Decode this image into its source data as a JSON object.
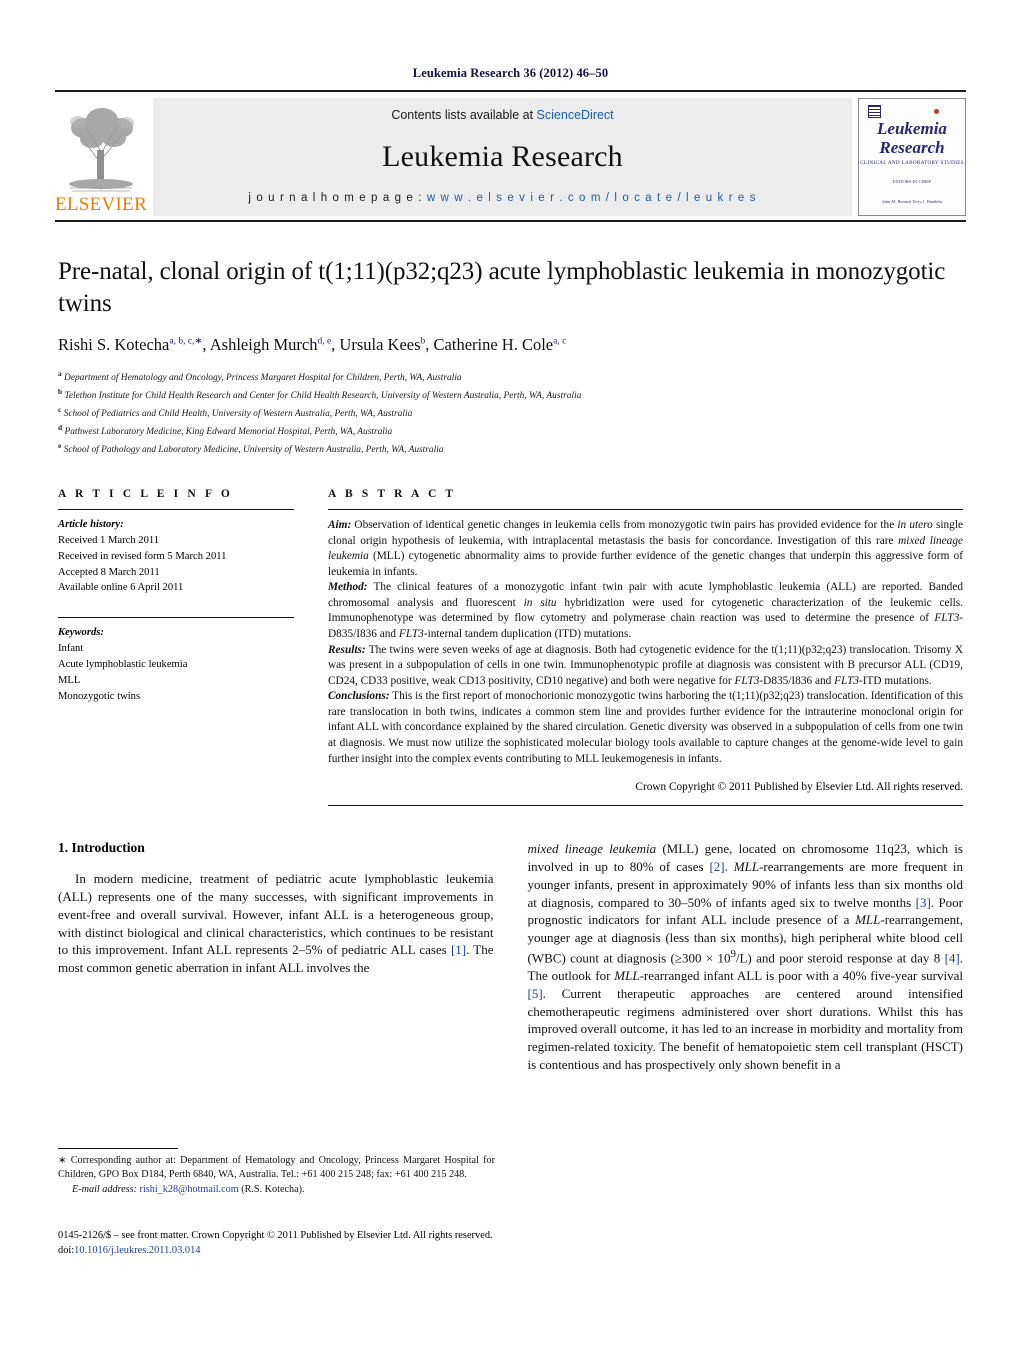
{
  "running_head": "Leukemia Research 36 (2012) 46–50",
  "masthead": {
    "contents_prefix": "Contents lists available at ",
    "sciencedirect": "ScienceDirect",
    "journal_name": "Leukemia Research",
    "homepage_prefix": "j o u r n a l   h o m e p a g e :   ",
    "homepage_url": "w w w . e l s e v i e r . c o m / l o c a t e / l e u k r e s",
    "publisher_logo_text": "ELSEVIER",
    "cover": {
      "title_line1": "Leukemia",
      "title_line2": "Research",
      "subtitle": "CLINICAL AND LABORATORY STUDIES",
      "editors_label": "EDITORS-IN-CHIEF",
      "editors": "John M. Bennett          Terry J. Hamblin"
    }
  },
  "article": {
    "title": "Pre-natal, clonal origin of t(1;11)(p32;q23) acute lymphoblastic leukemia in monozygotic twins",
    "authors": [
      {
        "name": "Rishi S. Kotecha",
        "sup": "a, b, c,∗"
      },
      {
        "name": "Ashleigh Murch",
        "sup": "d, e"
      },
      {
        "name": "Ursula Kees",
        "sup": "b"
      },
      {
        "name": "Catherine H. Cole",
        "sup": "a, c"
      }
    ],
    "affiliations": [
      {
        "mark": "a",
        "text": "Department of Hematology and Oncology, Princess Margaret Hospital for Children, Perth, WA, Australia"
      },
      {
        "mark": "b",
        "text": "Telethon Institute for Child Health Research and Center for Child Health Research, University of Western Australia, Perth, WA, Australia"
      },
      {
        "mark": "c",
        "text": "School of Pediatrics and Child Health, University of Western Australia, Perth, WA, Australia"
      },
      {
        "mark": "d",
        "text": "Pathwest Laboratory Medicine, King Edward Memorial Hospital, Perth, WA, Australia"
      },
      {
        "mark": "e",
        "text": "School of Pathology and Laboratory Medicine, University of Western Australia, Perth, WA, Australia"
      }
    ]
  },
  "article_info": {
    "heading": "A R T I C L E   I N F O",
    "history_label": "Article history:",
    "history": [
      "Received 1 March 2011",
      "Received in revised form 5 March 2011",
      "Accepted 8 March 2011",
      "Available online 6 April 2011"
    ],
    "keywords_label": "Keywords:",
    "keywords": [
      "Infant",
      "Acute lymphoblastic leukemia",
      "MLL",
      "Monozygotic twins"
    ]
  },
  "abstract": {
    "heading": "A B S T R A C T",
    "aim_label": "Aim:",
    "aim_text": " Observation of identical genetic changes in leukemia cells from monozygotic twin pairs has provided evidence for the <i>in utero</i> single clonal origin hypothesis of leukemia, with intraplacental metastasis the basis for concordance. Investigation of this rare <i>mixed lineage leukemia</i> (MLL) cytogenetic abnormality aims to provide further evidence of the genetic changes that underpin this aggressive form of leukemia in infants.",
    "method_label": "Method:",
    "method_text": " The clinical features of a monozygotic infant twin pair with acute lymphoblastic leukemia (ALL) are reported. Banded chromosomal analysis and fluorescent <i>in situ</i> hybridization were used for cytogenetic characterization of the leukemic cells. Immunophenotype was determined by flow cytometry and polymerase chain reaction was used to determine the presence of <i>FLT3</i>-D835/I836 and <i>FLT3</i>-internal tandem duplication (ITD) mutations.",
    "results_label": "Results:",
    "results_text": " The twins were seven weeks of age at diagnosis. Both had cytogenetic evidence for the t(1;11)(p32;q23) translocation. Trisomy X was present in a subpopulation of cells in one twin. Immunophenotypic profile at diagnosis was consistent with B precursor ALL (CD19, CD24, CD33 positive, weak CD13 positivity, CD10 negative) and both were negative for <i>FLT3</i>-D835/I836 and <i>FLT3</i>-ITD mutations.",
    "conclusions_label": "Conclusions:",
    "conclusions_text": " This is the first report of monochorionic monozygotic twins harboring the t(1;11)(p32;q23) translocation. Identification of this rare translocation in both twins, indicates a common stem line and provides further evidence for the intrauterine monoclonal origin for infant ALL with concordance explained by the shared circulation. Genetic diversity was observed in a subpopulation of cells from one twin at diagnosis. We must now utilize the sophisticated molecular biology tools available to capture changes at the genome-wide level to gain further insight into the complex events contributing to MLL leukemogenesis in infants.",
    "copyright": "Crown Copyright © 2011 Published by Elsevier Ltd. All rights reserved."
  },
  "introduction": {
    "heading": "1.  Introduction",
    "left_text": "In modern medicine, treatment of pediatric acute lymphoblastic leukemia (ALL) represents one of the many successes, with significant improvements in event-free and overall survival. However, infant ALL is a heterogeneous group, with distinct biological and clinical characteristics, which continues to be resistant to this improvement. Infant ALL represents 2–5% of pediatric ALL cases <span class=\"cit\">[1]</span>. The most common genetic aberration in infant ALL involves the",
    "right_text": "<i>mixed lineage leukemia</i> (MLL) gene, located on chromosome 11q23, which is involved in up to 80% of cases <span class=\"cit\">[2]</span>. <i>MLL</i>-rearrangements are more frequent in younger infants, present in approximately 90% of infants less than six months old at diagnosis, compared to 30–50% of infants aged six to twelve months <span class=\"cit\">[3]</span>. Poor prognostic indicators for infant ALL include presence of a <i>MLL</i>-rearrangement, younger age at diagnosis (less than six months), high peripheral white blood cell (WBC) count at diagnosis (≥300 × 10<sup>9</sup>/L) and poor steroid response at day 8 <span class=\"cit\">[4]</span>. The outlook for <i>MLL</i>-rearranged infant ALL is poor with a 40% five-year survival <span class=\"cit\">[5]</span>. Current therapeutic approaches are centered around intensified chemotherapeutic regimens administered over short durations. Whilst this has improved overall outcome, it has led to an increase in morbidity and mortality from regimen-related toxicity. The benefit of hematopoietic stem cell transplant (HSCT) is contentious and has prospectively only shown benefit in a"
  },
  "footnote": {
    "text": "<span class=\"star\">∗</span> Corresponding author at: Department of Hematology and Oncology, Princess Margaret Hospital for Children, GPO Box D184, Perth 6840, WA, Australia. Tel.: +61 400 215 248; fax: +61 400 215 248.",
    "email_label": "E-mail address:",
    "email": "rishi_k28@hotmail.com",
    "email_attrib": " (R.S. Kotecha)."
  },
  "bottom": {
    "issn_line": "0145-2126/$ – see front matter. Crown Copyright © 2011 Published by Elsevier Ltd. All rights reserved.",
    "doi_prefix": "doi:",
    "doi_value": "10.1016/j.leukres.2011.03.014"
  }
}
